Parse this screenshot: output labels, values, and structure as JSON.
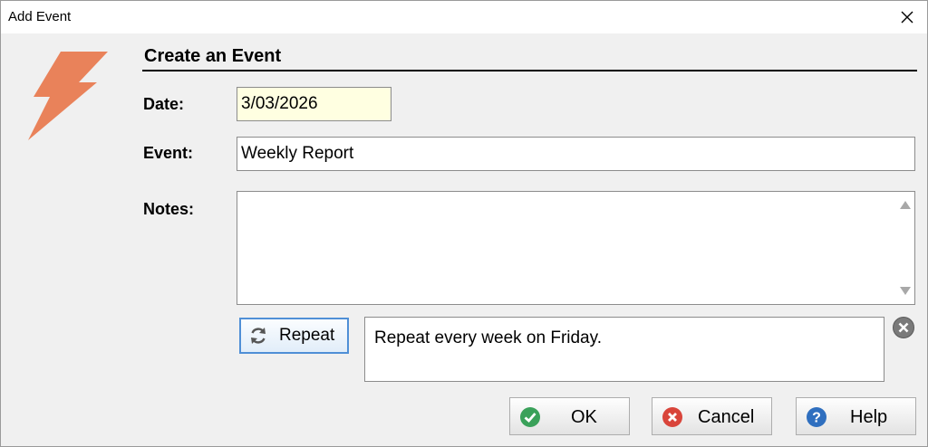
{
  "window": {
    "title": "Add Event"
  },
  "form": {
    "heading": "Create an Event",
    "date_label": "Date:",
    "date_value": "3/03/2026",
    "event_label": "Event:",
    "event_value": "Weekly Report",
    "notes_label": "Notes:",
    "notes_value": ""
  },
  "repeat": {
    "button_label": "Repeat",
    "summary": "Repeat every week on Friday."
  },
  "buttons": {
    "ok": "OK",
    "cancel": "Cancel",
    "help": "Help"
  },
  "colors": {
    "logo": "#e9825a",
    "date_bg": "#ffffe1",
    "ok_icon": "#3aa15a",
    "cancel_icon": "#d9453b",
    "help_icon": "#2f6fbf",
    "accent_border": "#4f8fd6"
  },
  "icons": {
    "logo": "lightning-bolt-icon",
    "close": "close-icon",
    "repeat": "refresh-icon",
    "clear": "clear-icon",
    "ok": "checkmark-icon",
    "cancel": "cancel-x-icon",
    "help": "help-question-icon"
  }
}
